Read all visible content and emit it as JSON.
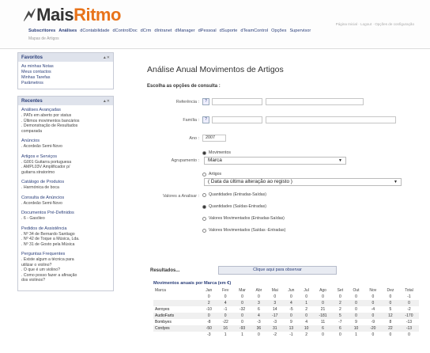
{
  "header": {
    "logo_mais": "Mais",
    "logo_ritmo": "Ritmo",
    "toplinks": "Página Inicial · Logout · Opções de configuração",
    "nav": [
      "Subscritores",
      "Análises",
      "dContabilidade",
      "dControlDoc",
      "dCrm",
      "dIntranet",
      "dManager",
      "dPessoal",
      "dSuporte",
      "dTeamControl",
      "Opções",
      "Supervisor"
    ],
    "subnav": "Mapas de Artigos"
  },
  "sidebar": {
    "favoritos": {
      "title": "Favoritos",
      "items": [
        "As minhas Notas",
        "Meus contactos",
        "Minhas Tarefas",
        "Parâmetros"
      ]
    },
    "recentes": {
      "title": "Recentes",
      "groups": [
        {
          "title": "Análises Avançadas",
          "items": [
            ". PATs em aberto por status",
            ". Últimos movimentos bancários",
            ". Demonstração de Resultados",
            "comparada"
          ]
        },
        {
          "title": "Anúncios",
          "items": [
            ". Acordeão Semi-Novo"
          ]
        },
        {
          "title": "Artigos e Serviços",
          "items": [
            ". G001 Guitarra portuguesa",
            ". AMPL03V Amplificador p/",
            "guitarra stratorimo"
          ]
        },
        {
          "title": "Catálogo de Produtos",
          "items": [
            ". Harmónica de boca"
          ]
        },
        {
          "title": "Consulta de Anúncios",
          "items": [
            ". Acordeão Semi-Novo"
          ]
        },
        {
          "title": "Documentos Pré-Definidos",
          "items": [
            ". 6 - Gasóleo"
          ]
        },
        {
          "title": "Pedidos de Assistência",
          "items": [
            ". Nº 34 de Bernardo Santiago",
            ". Nº 42 de Toque a Música, Lda.",
            ". Nº 31 de Gosto pela Música"
          ]
        },
        {
          "title": "Perguntas Frequentes",
          "items": [
            ". Existe algum a técnica para",
            "utilizar o violino?",
            ". O que é um violino?",
            ". Como posso fazer a afinação",
            "dos violinos?"
          ]
        }
      ]
    }
  },
  "main": {
    "title": "Análise Anual Movimentos de Artigos",
    "section": "Escolha as opções de consulta :",
    "form": {
      "referencia_label": "Referência :",
      "familia_label": "Família :",
      "ano_label": "Ano :",
      "ano_value": "2007",
      "agrupamento_label": "Agrupamento :",
      "agrup_movimentos": "Movimentos",
      "agrup_select": "Marca",
      "agrup_artigos": "Artigos",
      "agrup_artigos_select": "( Data da última alteração ao registo )",
      "valores_label": "Valores a Analisar :",
      "valores_options": [
        "Quantidades (Entradas-Saídas)",
        "Quantidades (Saídas-Entradas)",
        "Valores Movimentados (Entradas-Saídas)",
        "Valores Movimentados (Saídas -Entradas)"
      ],
      "valores_selected": 1,
      "lookup_glyph": "?",
      "submit": "Clique aqui para observar"
    },
    "results": {
      "title": "Resultados...",
      "table_title": "Movimentos anuais por Marca (em €)",
      "columns": [
        "Marca",
        "Jan",
        "Fev",
        "Mar",
        "Abr",
        "Mai",
        "Jun",
        "Jul",
        "Ago",
        "Set",
        "Out",
        "Nov",
        "Dez",
        "Total"
      ],
      "rows": [
        [
          "",
          "0",
          "0",
          "0",
          "0",
          "0",
          "0",
          "0",
          "0",
          "0",
          "0",
          "0",
          "0",
          "-1"
        ],
        [
          "",
          "2",
          "4",
          "0",
          "3",
          "3",
          "4",
          "1",
          "0",
          "2",
          "0",
          "0",
          "0",
          "0"
        ],
        [
          "Aeroyes",
          "-10",
          "-1",
          "-32",
          "6",
          "14",
          "-5",
          "2",
          "21",
          "2",
          "0",
          "-4",
          "5",
          "-2"
        ],
        [
          "AudioFarts",
          "0",
          "0",
          "0",
          "4",
          "-17",
          "0",
          "0",
          "-181",
          "5",
          "0",
          "0",
          "12",
          "-170"
        ],
        [
          "Bombyes",
          "-8",
          "-22",
          "0",
          "-3",
          "-3",
          "9",
          "4",
          "11",
          "-7",
          "9",
          "-9",
          "8",
          "-13"
        ],
        [
          "Cordyes",
          "-50",
          "16",
          "-93",
          "36",
          "31",
          "13",
          "10",
          "6",
          "6",
          "10",
          "-20",
          "22",
          "-13"
        ],
        [
          "",
          "-3",
          "1",
          "1",
          "0",
          "-2",
          "-1",
          "2",
          "0",
          "0",
          "1",
          "0",
          "0",
          "0"
        ]
      ]
    }
  }
}
